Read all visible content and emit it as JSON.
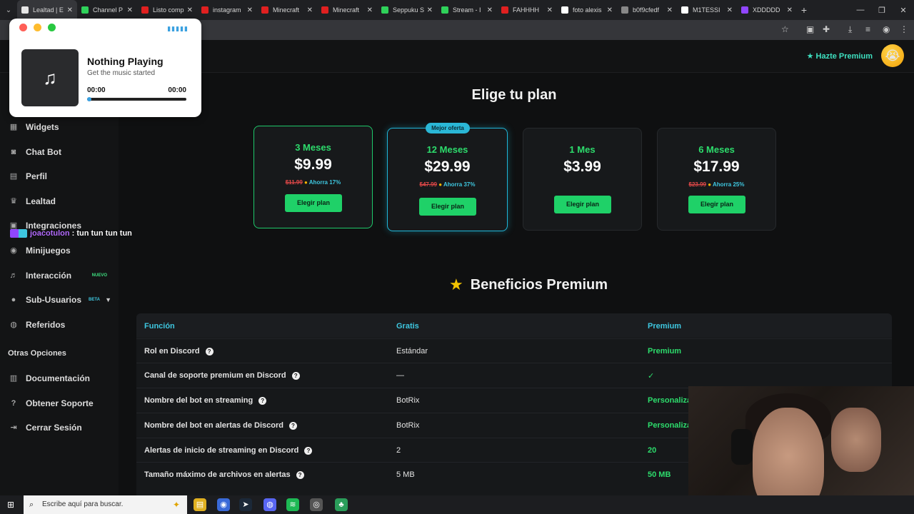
{
  "browser": {
    "tabs": [
      {
        "title": "Lealtad | E",
        "active": true,
        "color": "#e6e6e6"
      },
      {
        "title": "Channel P",
        "active": false,
        "color": "#2fd15a"
      },
      {
        "title": "Listo comp",
        "active": false,
        "color": "#e02020"
      },
      {
        "title": "instagram",
        "active": false,
        "color": "#e02020"
      },
      {
        "title": "Minecraft",
        "active": false,
        "color": "#e02020"
      },
      {
        "title": "Minecraft",
        "active": false,
        "color": "#e02020"
      },
      {
        "title": "Seppuku S",
        "active": false,
        "color": "#2fd15a"
      },
      {
        "title": "Stream - I",
        "active": false,
        "color": "#2fd15a"
      },
      {
        "title": "FAHHHH",
        "active": false,
        "color": "#e02020"
      },
      {
        "title": "foto alexis",
        "active": false,
        "color": "#ffffff"
      },
      {
        "title": "b0f9cfedf",
        "active": false,
        "color": "#888888"
      },
      {
        "title": "M1TESSI",
        "active": false,
        "color": "#ffffff"
      },
      {
        "title": "XDDDDD",
        "active": false,
        "color": "#9146ff"
      }
    ],
    "new_tab": "+",
    "window_controls": [
      "—",
      "❐",
      "✕"
    ]
  },
  "topbar": {
    "premium_label": "Hazte Premium",
    "avatar_emoji": "😭"
  },
  "music": {
    "title": "Nothing Playing",
    "subtitle": "Get the music started",
    "time_current": "00:00",
    "time_total": "00:00",
    "note_icon": "♫",
    "progress": 0.0
  },
  "sidebar": {
    "items": [
      {
        "label": "Widgets",
        "icon": "▦"
      },
      {
        "label": "Chat Bot",
        "icon": "◙"
      },
      {
        "label": "Perfil",
        "icon": "▤"
      },
      {
        "label": "Lealtad",
        "icon": "♛"
      },
      {
        "label": "Integraciones",
        "icon": "▣"
      },
      {
        "label": "Minijuegos",
        "icon": "◉"
      },
      {
        "label": "Interacción",
        "icon": "♬",
        "badge": "NUEVO"
      },
      {
        "label": "Sub-Usuarios",
        "icon": "●",
        "badge": "BETA"
      },
      {
        "label": "Referidos",
        "icon": "◍"
      }
    ],
    "section_label": "Otras Opciones",
    "other": [
      {
        "label": "Documentación",
        "icon": "▥"
      },
      {
        "label": "Obtener Soporte",
        "icon": "?"
      },
      {
        "label": "Cerrar Sesión",
        "icon": "⇥"
      }
    ]
  },
  "chat_overlay": {
    "user": "joacotulon",
    "message": ": tun tun tun tun"
  },
  "plans": {
    "title": "Elige tu plan",
    "cards": [
      {
        "name": "3 Meses",
        "price": "$9.99",
        "old": "$11.99",
        "save": "Ahorra 17%",
        "button": "Elegir plan"
      },
      {
        "name": "12 Meses",
        "price": "$29.99",
        "old": "$47.99",
        "save": "Ahorra 37%",
        "button": "Elegir plan",
        "tag": "Mejor oferta"
      },
      {
        "name": "1 Mes",
        "price": "$3.99",
        "button": "Elegir plan"
      },
      {
        "name": "6 Meses",
        "price": "$17.99",
        "old": "$23.99",
        "save": "Ahorra 25%",
        "button": "Elegir plan"
      }
    ]
  },
  "benefits": {
    "title": "Beneficios Premium",
    "headers": [
      "Función",
      "Gratis",
      "Premium"
    ],
    "rows": [
      {
        "feature": "Rol en Discord",
        "free": "Estándar",
        "premium": "Premium"
      },
      {
        "feature": "Canal de soporte premium en Discord",
        "free": "—",
        "premium": "✓"
      },
      {
        "feature": "Nombre del bot en streaming",
        "free": "BotRix",
        "premium": "Personaliza"
      },
      {
        "feature": "Nombre del bot en alertas de Discord",
        "free": "BotRix",
        "premium": "Personaliza"
      },
      {
        "feature": "Alertas de inicio de streaming en Discord",
        "free": "2",
        "premium": "20"
      },
      {
        "feature": "Tamaño máximo de archivos en alertas",
        "free": "5 MB",
        "premium": "50 MB"
      }
    ]
  },
  "taskbar": {
    "search_placeholder": "Escribe aquí para buscar."
  }
}
